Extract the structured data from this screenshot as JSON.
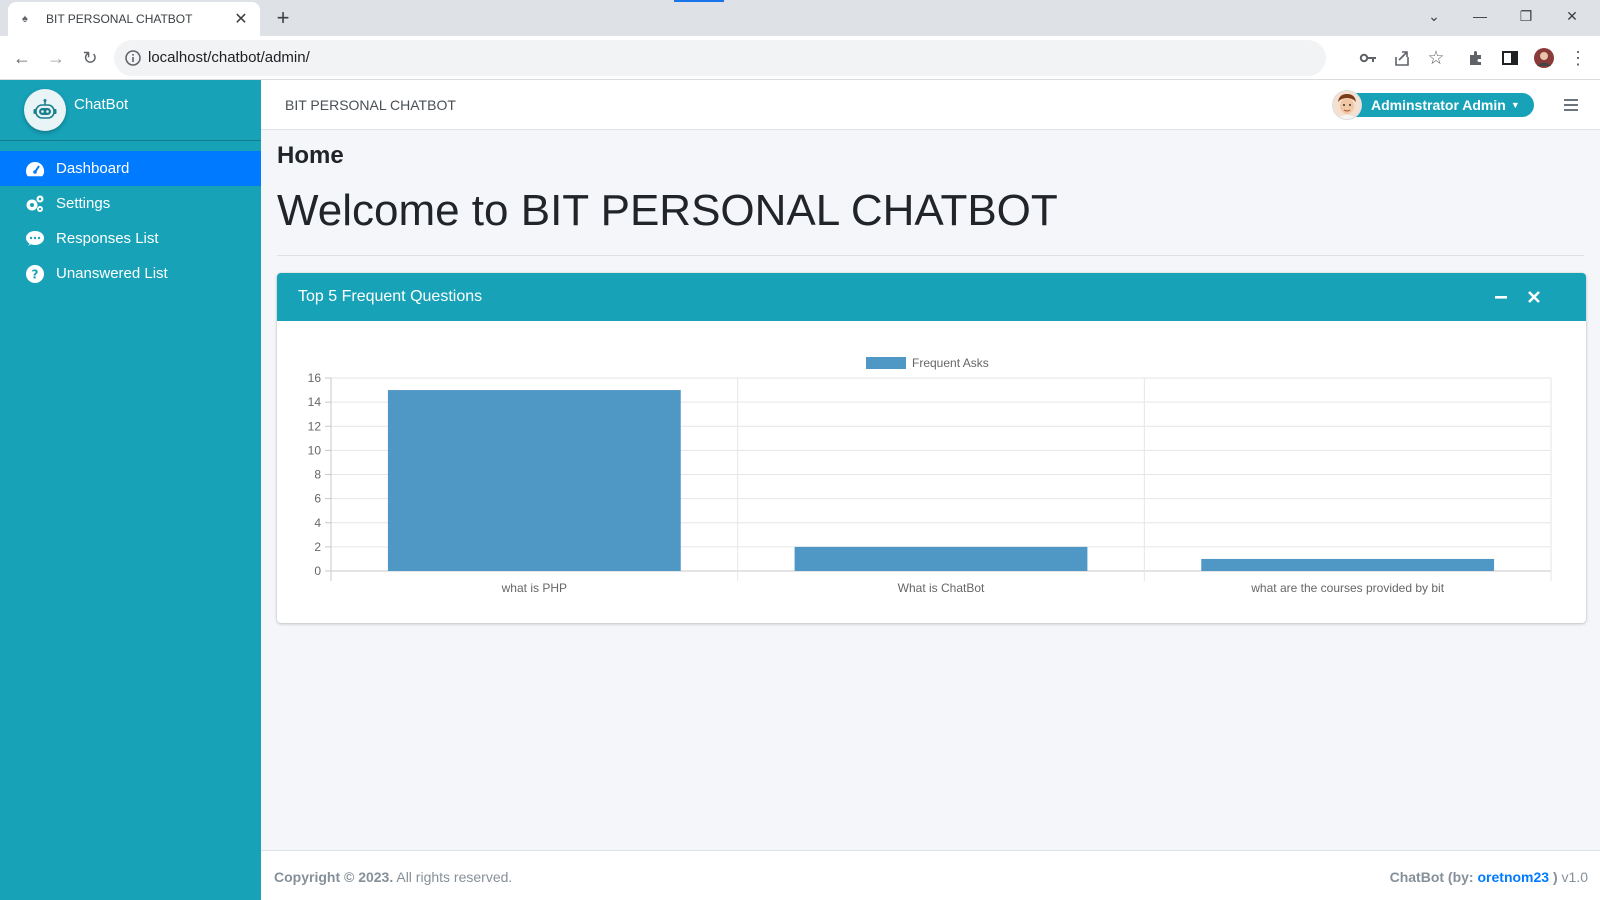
{
  "browser": {
    "tab_title": "BIT PERSONAL CHATBOT",
    "url": "localhost/chatbot/admin/"
  },
  "sidebar": {
    "brand": "ChatBot",
    "items": [
      {
        "label": "Dashboard",
        "icon": "tachometer-icon",
        "active": true
      },
      {
        "label": "Settings",
        "icon": "cogs-icon",
        "active": false
      },
      {
        "label": "Responses List",
        "icon": "comment-dots-icon",
        "active": false
      },
      {
        "label": "Unanswered List",
        "icon": "question-circle-icon",
        "active": false
      }
    ]
  },
  "header": {
    "site_name": "BIT PERSONAL CHATBOT",
    "user": "Adminstrator Admin"
  },
  "main": {
    "page_title": "Home",
    "welcome": "Welcome to BIT PERSONAL CHATBOT",
    "card_title": "Top 5 Frequent Questions"
  },
  "chart_data": {
    "type": "bar",
    "title": "",
    "xlabel": "",
    "ylabel": "",
    "categories": [
      "what is PHP",
      "What is ChatBot",
      "what are the courses provided by bit"
    ],
    "series": [
      {
        "name": "Frequent Asks",
        "values": [
          15,
          2,
          1
        ],
        "color": "#4f97c4"
      }
    ],
    "ylim": [
      0,
      16
    ],
    "yticks": [
      0,
      2,
      4,
      6,
      8,
      10,
      12,
      14,
      16
    ],
    "grid": true,
    "legend_position": "top-center"
  },
  "footer": {
    "copyright": "Copyright © 2023.",
    "rights": " All rights reserved.",
    "credit_prefix": "ChatBot (by: ",
    "credit_author": "oretnom23",
    "credit_suffix": " )",
    "version": " v1.0"
  },
  "colors": {
    "sidebar": "#17a2b8",
    "active_nav": "#007bff",
    "bar": "#4f97c4"
  }
}
